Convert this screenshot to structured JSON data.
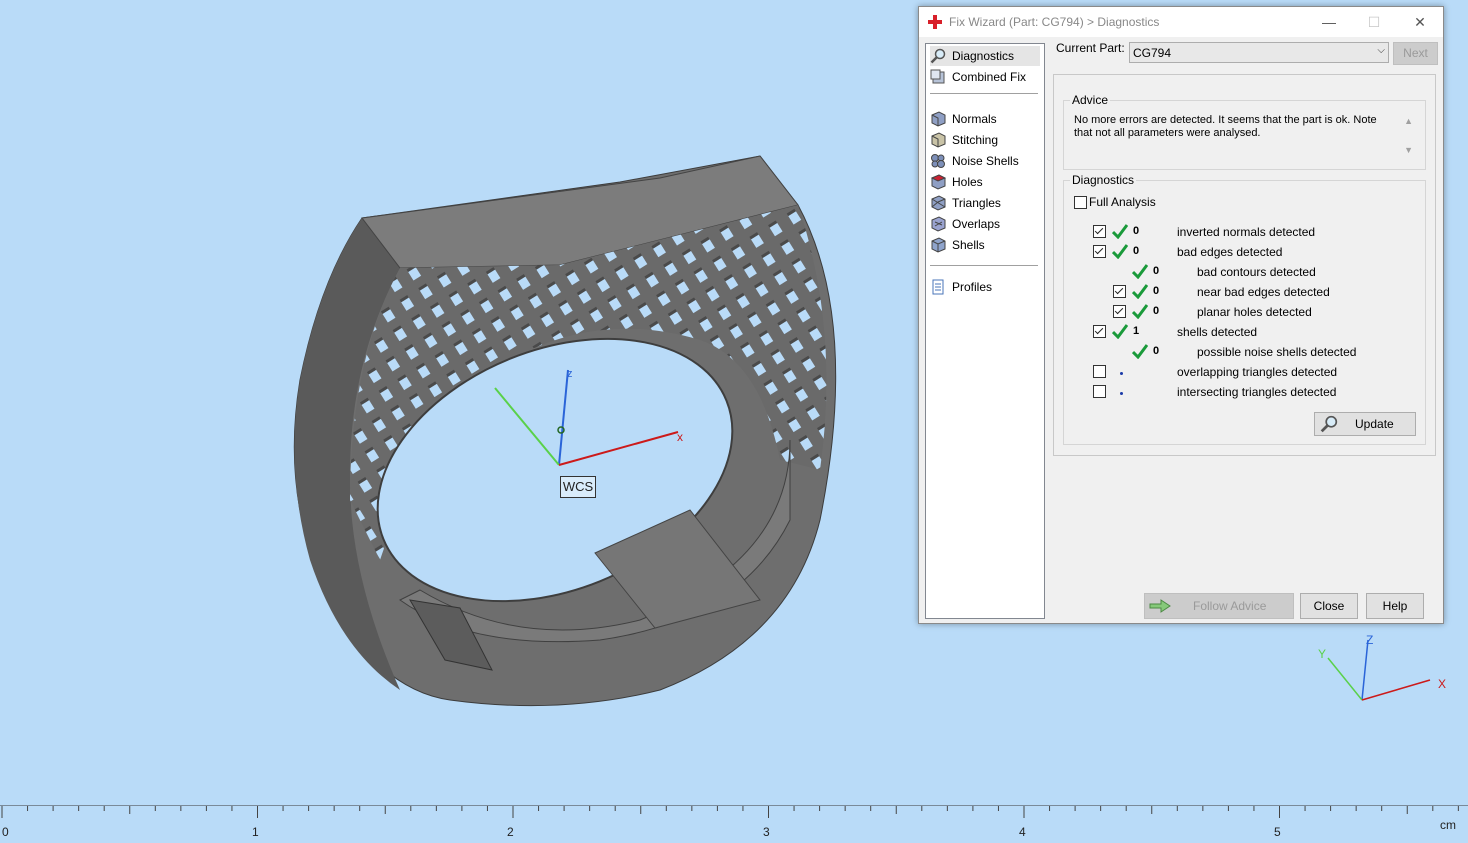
{
  "window": {
    "title": "Fix Wizard (Part: CG794) > Diagnostics",
    "minimize_glyph": "—",
    "maximize_glyph": "☐",
    "close_glyph": "✕"
  },
  "nav": {
    "items": [
      {
        "label": "Diagnostics",
        "icon": "magnifier-icon"
      },
      {
        "label": "Combined Fix",
        "icon": "combined-fix-icon"
      },
      {
        "label": "Normals",
        "icon": "normals-cube-icon"
      },
      {
        "label": "Stitching",
        "icon": "stitching-cube-icon"
      },
      {
        "label": "Noise Shells",
        "icon": "noise-shells-icon"
      },
      {
        "label": "Holes",
        "icon": "holes-cube-icon"
      },
      {
        "label": "Triangles",
        "icon": "triangles-cube-icon"
      },
      {
        "label": "Overlaps",
        "icon": "overlaps-cube-icon"
      },
      {
        "label": "Shells",
        "icon": "shells-cube-icon"
      },
      {
        "label": "Profiles",
        "icon": "profiles-document-icon"
      }
    ],
    "selected": "Diagnostics"
  },
  "current_part": {
    "label": "Current Part:",
    "value": "CG794",
    "next_label": "Next"
  },
  "advice": {
    "title": "Advice",
    "text": "No more errors are detected. It seems that the part is ok. Note that not all parameters were analysed."
  },
  "diagnostics": {
    "title": "Diagnostics",
    "full_analysis_label": "Full Analysis",
    "full_analysis_checked": false,
    "rows": [
      {
        "checkbox": true,
        "checked": true,
        "ok": true,
        "count": "0",
        "label": "inverted normals detected",
        "indent": 0
      },
      {
        "checkbox": true,
        "checked": true,
        "ok": true,
        "count": "0",
        "label": "bad edges detected",
        "indent": 0
      },
      {
        "checkbox": false,
        "checked": false,
        "ok": true,
        "count": "0",
        "label": "bad contours detected",
        "indent": 1
      },
      {
        "checkbox": true,
        "checked": true,
        "ok": true,
        "count": "0",
        "label": "near bad edges detected",
        "indent": 1
      },
      {
        "checkbox": true,
        "checked": true,
        "ok": true,
        "count": "0",
        "label": "planar holes detected",
        "indent": 1
      },
      {
        "checkbox": true,
        "checked": true,
        "ok": true,
        "count": "1",
        "label": "shells detected",
        "indent": 0
      },
      {
        "checkbox": false,
        "checked": false,
        "ok": true,
        "count": "0",
        "label": "possible noise shells detected",
        "indent": 1
      },
      {
        "checkbox": true,
        "checked": false,
        "ok": false,
        "count": "•",
        "label": "overlapping triangles detected",
        "indent": 0
      },
      {
        "checkbox": true,
        "checked": false,
        "ok": false,
        "count": "•",
        "label": "intersecting triangles detected",
        "indent": 0
      }
    ],
    "update_label": "Update"
  },
  "footer": {
    "follow_advice_label": "Follow Advice",
    "close_label": "Close",
    "help_label": "Help"
  },
  "viewport": {
    "wcs_label": "WCS",
    "axis_x": "x",
    "axis_z": "z",
    "mini_axis_x": "X",
    "mini_axis_y": "Y",
    "mini_axis_z": "Z"
  },
  "ruler": {
    "labels": [
      "0",
      "1",
      "2",
      "3",
      "4",
      "5"
    ],
    "unit": "cm"
  },
  "colors": {
    "viewport_bg": "#b9dbf8",
    "check_green": "#1a9a3a",
    "axis_x": "#cc1a1a",
    "axis_y": "#5ad14a",
    "axis_z": "#2a64d8"
  }
}
